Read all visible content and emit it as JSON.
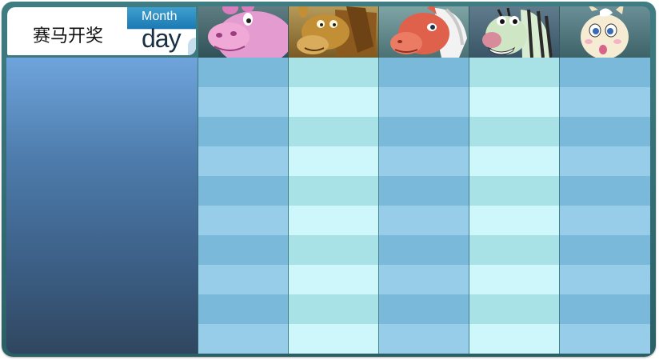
{
  "header": {
    "title": "赛马开奖",
    "month_label": "Month",
    "day_label": "day"
  },
  "racers": [
    {
      "name": "pink-hippo",
      "color": "#e98fc9"
    },
    {
      "name": "brown-donkey",
      "color": "#c08c30"
    },
    {
      "name": "red-horse",
      "color": "#e0614b"
    },
    {
      "name": "zebra",
      "color": "#cfe6c4"
    },
    {
      "name": "cream-llama",
      "color": "#f6ecd3"
    }
  ],
  "grid": {
    "rows": 10,
    "columns": 5
  },
  "colors": {
    "frame": "#2f6a70",
    "panel_top": "#6ea4dc",
    "panel_bottom": "#30465f",
    "cell_blue": "#7ab9d9",
    "cell_cyan": "#cdf7fa"
  }
}
